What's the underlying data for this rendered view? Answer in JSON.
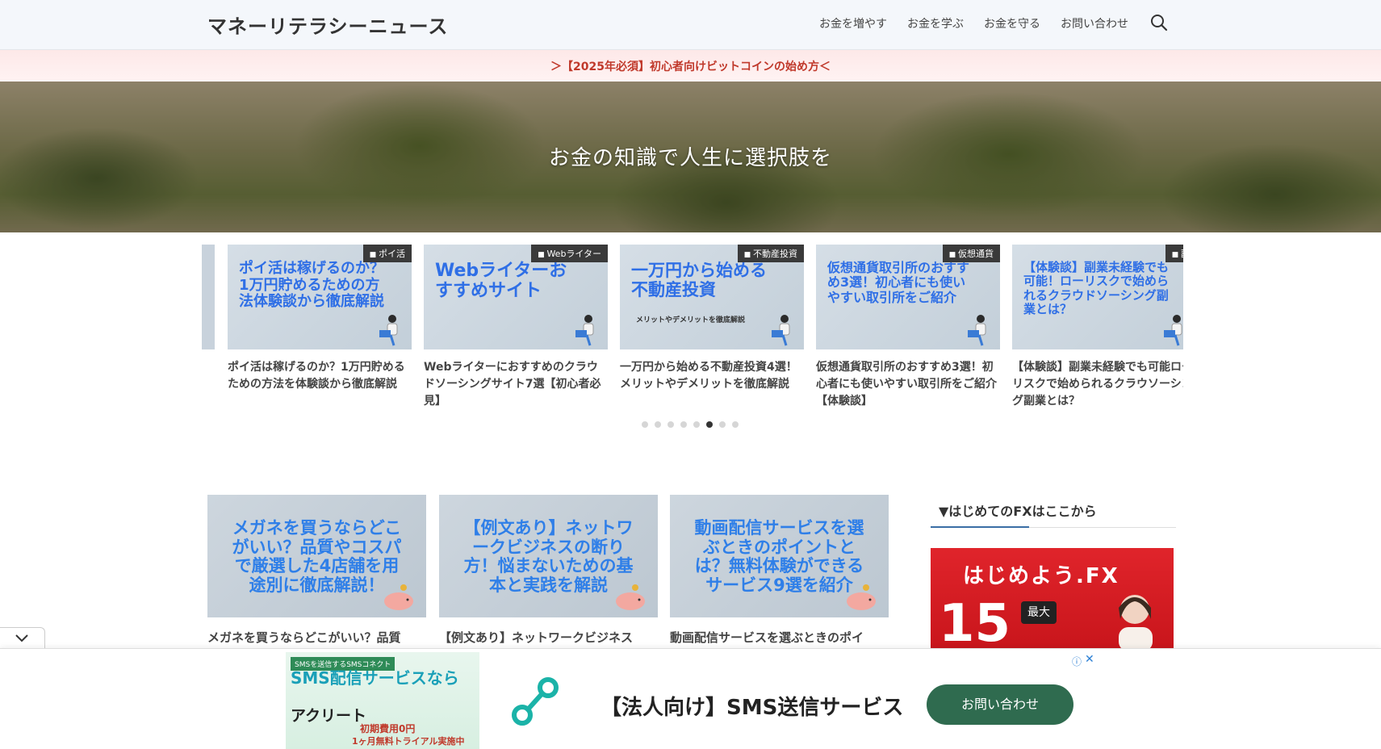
{
  "header": {
    "site_title": "マネーリテラシーニュース",
    "nav": [
      "お金を増やす",
      "お金を学ぶ",
      "お金を守る",
      "お問い合わせ"
    ]
  },
  "notice": {
    "text": "＞【2025年必須】初心者向けビットコインの始め方＜"
  },
  "hero": {
    "title": "お金の知識で人生に選択肢を"
  },
  "carousel": {
    "slides": [
      {
        "category": "ポイ活",
        "thumb_text": "ポイ活は稼げるのか？1万円貯めるための方法体験談から徹底解説",
        "title": "ポイ活は稼げるのか？1万円貯めるための方法を体験談から徹底解説"
      },
      {
        "category": "Webライター",
        "thumb_text": "Webライターおすすめサイト",
        "title": "Webライターにおすすめのクラウドソーシングサイト7選【初心者必見】"
      },
      {
        "category": "不動産投資",
        "thumb_text": "一万円から始める不動産投資",
        "thumb_sub": "メリットやデメリットを徹底解説",
        "title": "一万円から始める不動産投資4選！メリットやデメリットを徹底解説"
      },
      {
        "category": "仮想通貨",
        "thumb_text": "仮想通貨取引所のおすすめ3選！初心者にも使いやすい取引所をご紹介",
        "title": "仮想通貨取引所のおすすめ3選！初心者にも使いやすい取引所をご紹介【体験談】"
      },
      {
        "category": "副",
        "thumb_text": "【体験談】副業未経験でも可能！ローリスクで始められるクラウドソーシング副業とは？",
        "title": "【体験談】副業未経験でも可能ローリスクで始められるクラウソーシング副業とは？"
      }
    ],
    "dots": {
      "count": 8,
      "active": 5
    }
  },
  "posts": [
    {
      "thumb_text": "メガネを買うならどこがいい？品質やコスパで厳選した4店舗を用途別に徹底解説！",
      "title": "メガネを買うならどこがいい？品質"
    },
    {
      "thumb_text": "【例文あり】ネットワークビジネスの断り方！悩まないための基本と実践を解説",
      "title": "【例文あり】ネットワークビジネス"
    },
    {
      "thumb_text": "動画配信サービスを選ぶときのポイントとは？無料体験ができるサービス9選を紹介",
      "title": "動画配信サービスを選ぶときのポイ"
    }
  ],
  "sidebar": {
    "heading": "▼はじめてのFXはここから",
    "banner": {
      "headline": "はじめよう.FX",
      "big_number": "15",
      "badge": "最大"
    }
  },
  "ad": {
    "image_tag": "SMSを送信するSMSコネクト",
    "image_main": "SMS配信サービスなら",
    "image_sub": "アクリート",
    "image_price": "初期費用0円",
    "image_trial": "1ヶ月無料トライアル実施中",
    "title": "【法人向け】SMS送信サービス",
    "cta": "お問い合わせ",
    "info": "ⓘ",
    "close": "✕"
  },
  "colors": {
    "accent_blue": "#2f6fe6",
    "notice_red": "#c0392b",
    "cta_green": "#2f6b4f",
    "fx_red": "#e0242b"
  }
}
